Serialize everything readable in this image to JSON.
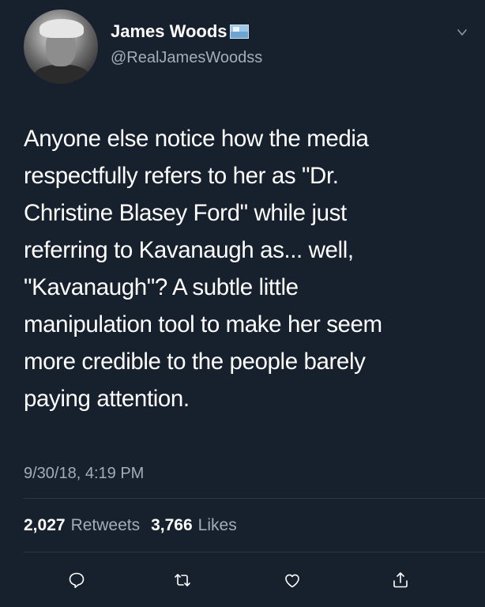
{
  "user": {
    "display_name": "James Woods",
    "handle": "@RealJamesWoodss",
    "badge_icon": "flag-icon"
  },
  "tweet": {
    "text": "Anyone else notice how the media respectfully refers to her as \"Dr. Christine Blasey Ford\" while just referring to Kavanaugh as... well, \"Kavanaugh\"? A subtle little manipulation tool to make her seem more credible to the people barely paying attention.",
    "lines": [
      "Anyone else notice how the media",
      "respectfully refers to her as \"Dr.",
      "Christine Blasey Ford\" while just",
      "referring to Kavanaugh as... well,",
      "\"Kavanaugh\"? A subtle little",
      "manipulation tool to make her seem",
      "more credible to the people barely",
      "paying attention."
    ],
    "timestamp": "9/30/18, 4:19 PM"
  },
  "stats": {
    "retweets_count": "2,027",
    "retweets_label": "Retweets",
    "likes_count": "3,766",
    "likes_label": "Likes"
  },
  "actions": [
    "reply-icon",
    "retweet-icon",
    "like-icon",
    "share-icon"
  ],
  "colors": {
    "background": "#17212e",
    "text": "#ffffff",
    "secondary_text": "#a2adbb",
    "divider": "#2c3846"
  }
}
